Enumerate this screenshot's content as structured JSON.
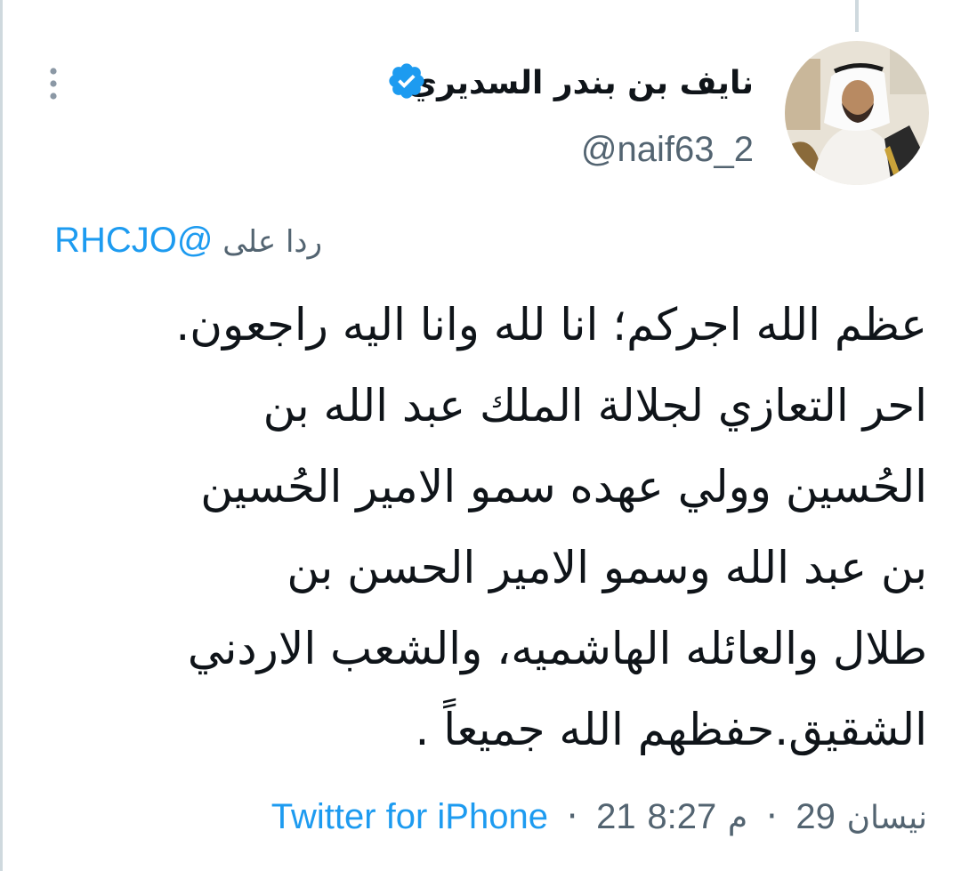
{
  "author": {
    "display_name": "نايف بن بندر السديري",
    "handle": "@naif63_2",
    "verified": true
  },
  "reply": {
    "prefix": "ردا على",
    "mention": "@RHCJO"
  },
  "tweet": {
    "lines": [
      "عظم الله اجركم؛ انا لله وانا اليه راجعون.",
      "احر التعازي لجلالة الملك عبد الله بن",
      "الحُسين وولي عهده سمو الامير الحُسين",
      "بن عبد الله وسمو الامير الحسن بن",
      "طلال والعائله الهاشميه، والشعب الاردني",
      "الشقيق.حفظهم الله جميعاً ."
    ]
  },
  "meta": {
    "time": "8:27",
    "period": "م",
    "date_day": "29",
    "date_month": "نيسان",
    "date_year": "21",
    "separator": "·",
    "source": "Twitter for iPhone"
  },
  "colors": {
    "link": "#1d9bf0",
    "secondary_text": "#536471",
    "primary_text": "#0f1419",
    "verified_badge": "#1d9bf0"
  },
  "icons": {
    "verified": "verified-badge-icon",
    "more": "more-vertical-icon"
  }
}
